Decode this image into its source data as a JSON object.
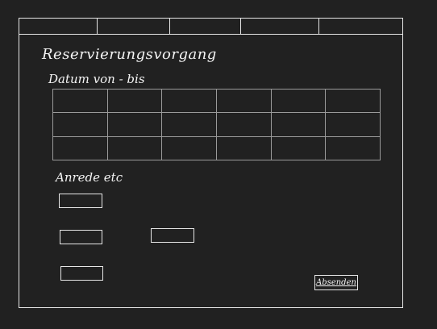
{
  "tabs": [
    {
      "label": ""
    },
    {
      "label": ""
    },
    {
      "label": ""
    },
    {
      "label": ""
    },
    {
      "label": ""
    }
  ],
  "form": {
    "title": "Reservierungsvorgang",
    "date_label": "Datum von - bis",
    "section_label": "Anrede etc",
    "fields": [
      {
        "value": "",
        "placeholder": ""
      },
      {
        "value": "",
        "placeholder": ""
      },
      {
        "value": "",
        "placeholder": ""
      },
      {
        "value": "",
        "placeholder": ""
      }
    ],
    "submit_label": "Absenden"
  },
  "date_grid": {
    "rows": [
      [
        "",
        "",
        "",
        "",
        "",
        ""
      ],
      [
        "",
        "",
        "",
        "",
        "",
        ""
      ],
      [
        "",
        "",
        "",
        "",
        "",
        ""
      ]
    ]
  }
}
